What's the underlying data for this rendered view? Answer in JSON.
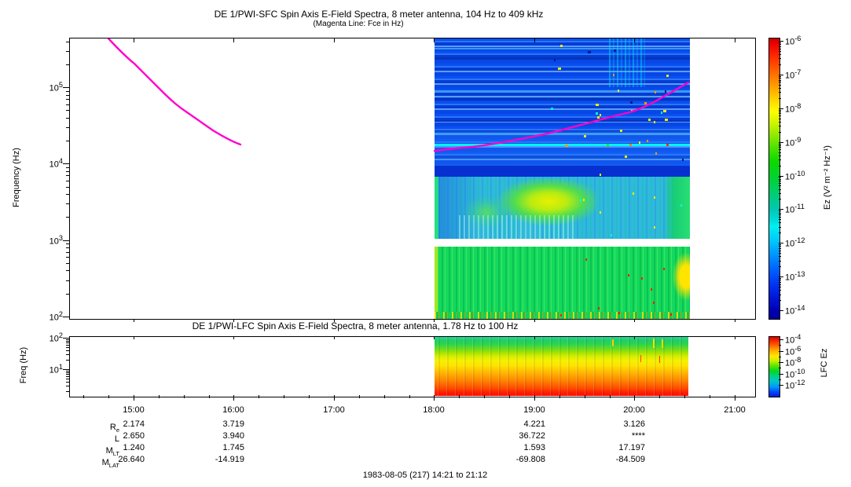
{
  "panels": {
    "sfc": {
      "title": "DE 1/PWI-SFC  Spin Axis E-Field Spectra, 8 meter antenna, 104 Hz to 409 kHz",
      "subtitle": "(Magenta Line: Fce in Hz)",
      "ylabel": "Frequency (Hz)",
      "ytick_exponents": [
        5,
        4,
        3,
        2
      ],
      "colorbar_label": "Ez (V² m⁻² Hz⁻¹)",
      "colorbar_tick_exponents": [
        -6,
        -7,
        -8,
        -9,
        -10,
        -11,
        -12,
        -13,
        -14
      ]
    },
    "lfc": {
      "title": "DE 1/PWI-LFC  Spin Axis E-Field Spectra, 8 meter antenna, 1.78 Hz to 100 Hz",
      "ylabel": "Freq (Hz)",
      "ytick_exponents": [
        2,
        1
      ],
      "colorbar_label": "LFC Ez",
      "colorbar_tick_exponents": [
        -4,
        -6,
        -8,
        -10,
        -12
      ]
    }
  },
  "xaxis": {
    "tick_labels": [
      "15:00",
      "16:00",
      "17:00",
      "18:00",
      "19:00",
      "20:00",
      "21:00"
    ]
  },
  "ephemeris": {
    "column_times": [
      "15:00",
      "16:00",
      "19:00",
      "20:00"
    ],
    "rows": [
      {
        "label_base": "R",
        "label_sub": "e",
        "values": [
          "2.174",
          "3.719",
          "4.221",
          "3.126"
        ]
      },
      {
        "label_base": "L",
        "label_sub": "",
        "values": [
          "2.650",
          "3.940",
          "36.722",
          "****"
        ]
      },
      {
        "label_base": "M",
        "label_sub": "LT",
        "values": [
          "1.240",
          "1.745",
          "1.593",
          "17.197"
        ]
      },
      {
        "label_base": "M",
        "label_sub": "LAT",
        "values": [
          "26.640",
          "-14.919",
          "-69.808",
          "-84.509"
        ]
      }
    ]
  },
  "footer": {
    "date_range": "1983-08-05 (217) 14:21 to 21:12"
  },
  "colors": {
    "fce_line": "#ff00cc",
    "cyan_line": "#00f0ff",
    "frame": "#000000"
  },
  "chart_data": [
    {
      "type": "heatmap",
      "instrument": "DE 1/PWI-SFC",
      "title": "DE 1/PWI-SFC Spin Axis E-Field Spectra, 8 meter antenna, 104 Hz to 409 kHz",
      "annotation": "(Magenta Line: Fce in Hz)",
      "ylabel": "Frequency (Hz)",
      "yscale": "log",
      "ylim_hz": [
        104,
        460000
      ],
      "ytick_labels": [
        "10^5",
        "10^4",
        "10^3",
        "10^2"
      ],
      "x_time_range": [
        "14:21",
        "21:12"
      ],
      "x_ticks": [
        "15:00",
        "16:00",
        "17:00",
        "18:00",
        "19:00",
        "20:00",
        "21:00"
      ],
      "grid": false,
      "colorbar": {
        "label": "Ez (V² m⁻² Hz⁻¹)",
        "scale": "log",
        "min": 1e-14,
        "max": 1e-06,
        "tick_labels": [
          "10^-6",
          "10^-7",
          "10^-8",
          "10^-9",
          "10^-10",
          "10^-11",
          "10^-12",
          "10^-13",
          "10^-14"
        ]
      },
      "data_interval": [
        "18:00",
        "20:30"
      ],
      "fce_line": {
        "color": "#ff00cc",
        "segments": [
          {
            "time": [
              "14:44",
              "16:00"
            ],
            "freq_hz_start": 440000,
            "freq_hz_end": 19000
          },
          {
            "time": [
              "18:00",
              "20:30"
            ],
            "freq_hz_start": 16000,
            "freq_hz_end": 115000
          }
        ]
      },
      "features": [
        "Banded blue emission (~1e-13 V2/m2/Hz) above ~7 kHz for 18:00-20:30",
        "Narrow cyan line near 18 kHz across the full data interval",
        "Yellow-green enhancement (chorus/hiss) 1-6 kHz near 18:40-19:30",
        "White data-gap band near 0.8-1 kHz",
        "Broadband green emission 100-800 Hz with yellow enhancement near 20:25",
        "Scattered impulsive yellow/cyan pixels above 10 kHz after ~19:50"
      ]
    },
    {
      "type": "heatmap",
      "instrument": "DE 1/PWI-LFC",
      "title": "DE 1/PWI-LFC Spin Axis E-Field Spectra, 8 meter antenna, 1.78 Hz to 100 Hz",
      "ylabel": "Freq (Hz)",
      "yscale": "log",
      "ylim_hz": [
        1.78,
        100
      ],
      "ytick_labels": [
        "10^2",
        "10^1"
      ],
      "x_time_range": [
        "14:21",
        "21:12"
      ],
      "grid": false,
      "colorbar": {
        "label": "LFC Ez",
        "scale": "log",
        "min": 1e-12,
        "max": 0.0001,
        "tick_labels": [
          "10^-4",
          "10^-6",
          "10^-8",
          "10^-10",
          "10^-12"
        ]
      },
      "data_interval": [
        "18:00",
        "20:30"
      ],
      "features": [
        "Intensity increases toward lower frequency: green/cyan near 100 Hz grading through yellow and orange to saturated red near 2 Hz"
      ]
    }
  ]
}
